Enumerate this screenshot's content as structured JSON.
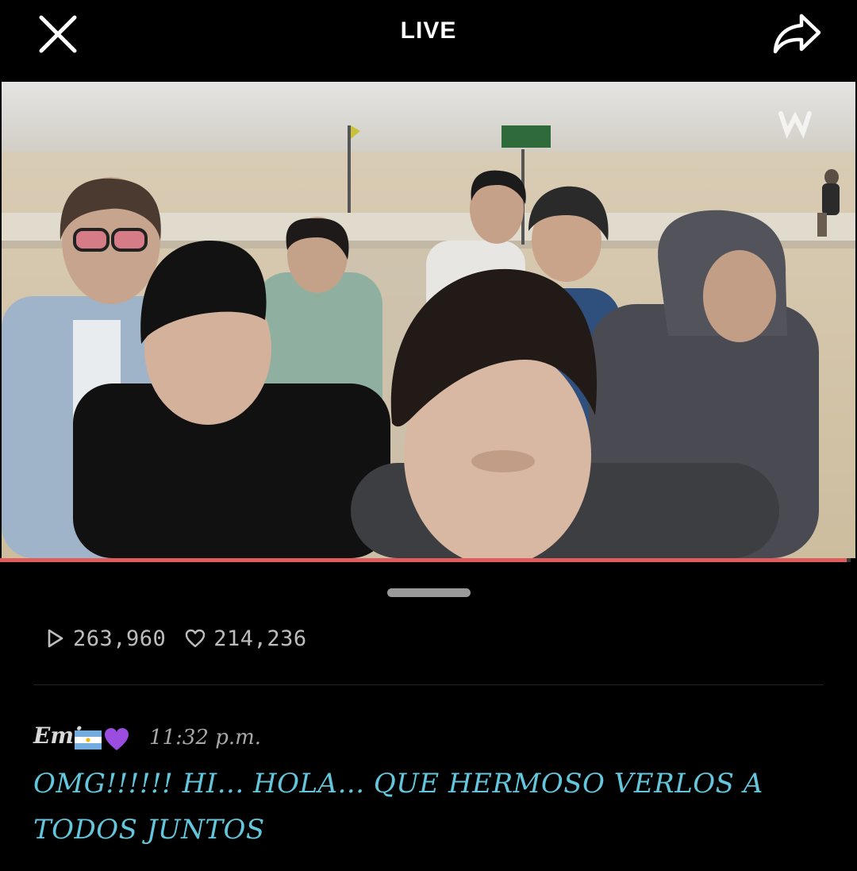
{
  "header": {
    "title": "LIVE",
    "close_icon": "close-icon",
    "share_icon": "share-arrow-icon"
  },
  "video": {
    "description_icon": "broadcaster-watermark-icon",
    "progress_fraction": 0.995,
    "progress_color": "#e05c5c"
  },
  "stats": {
    "plays": "263,960",
    "likes": "214,236",
    "play_icon": "play-icon",
    "like_icon": "heart-outline-icon"
  },
  "comment": {
    "author": "Emi",
    "author_emojis": [
      "argentina-flag-icon",
      "purple-heart-icon"
    ],
    "time": "11:32 p.m.",
    "text": "OMG!!!!!! HI... HOLA... QUE HERMOSO VERLOS A TODOS JUNTOS",
    "text_color": "#63c6dc"
  }
}
